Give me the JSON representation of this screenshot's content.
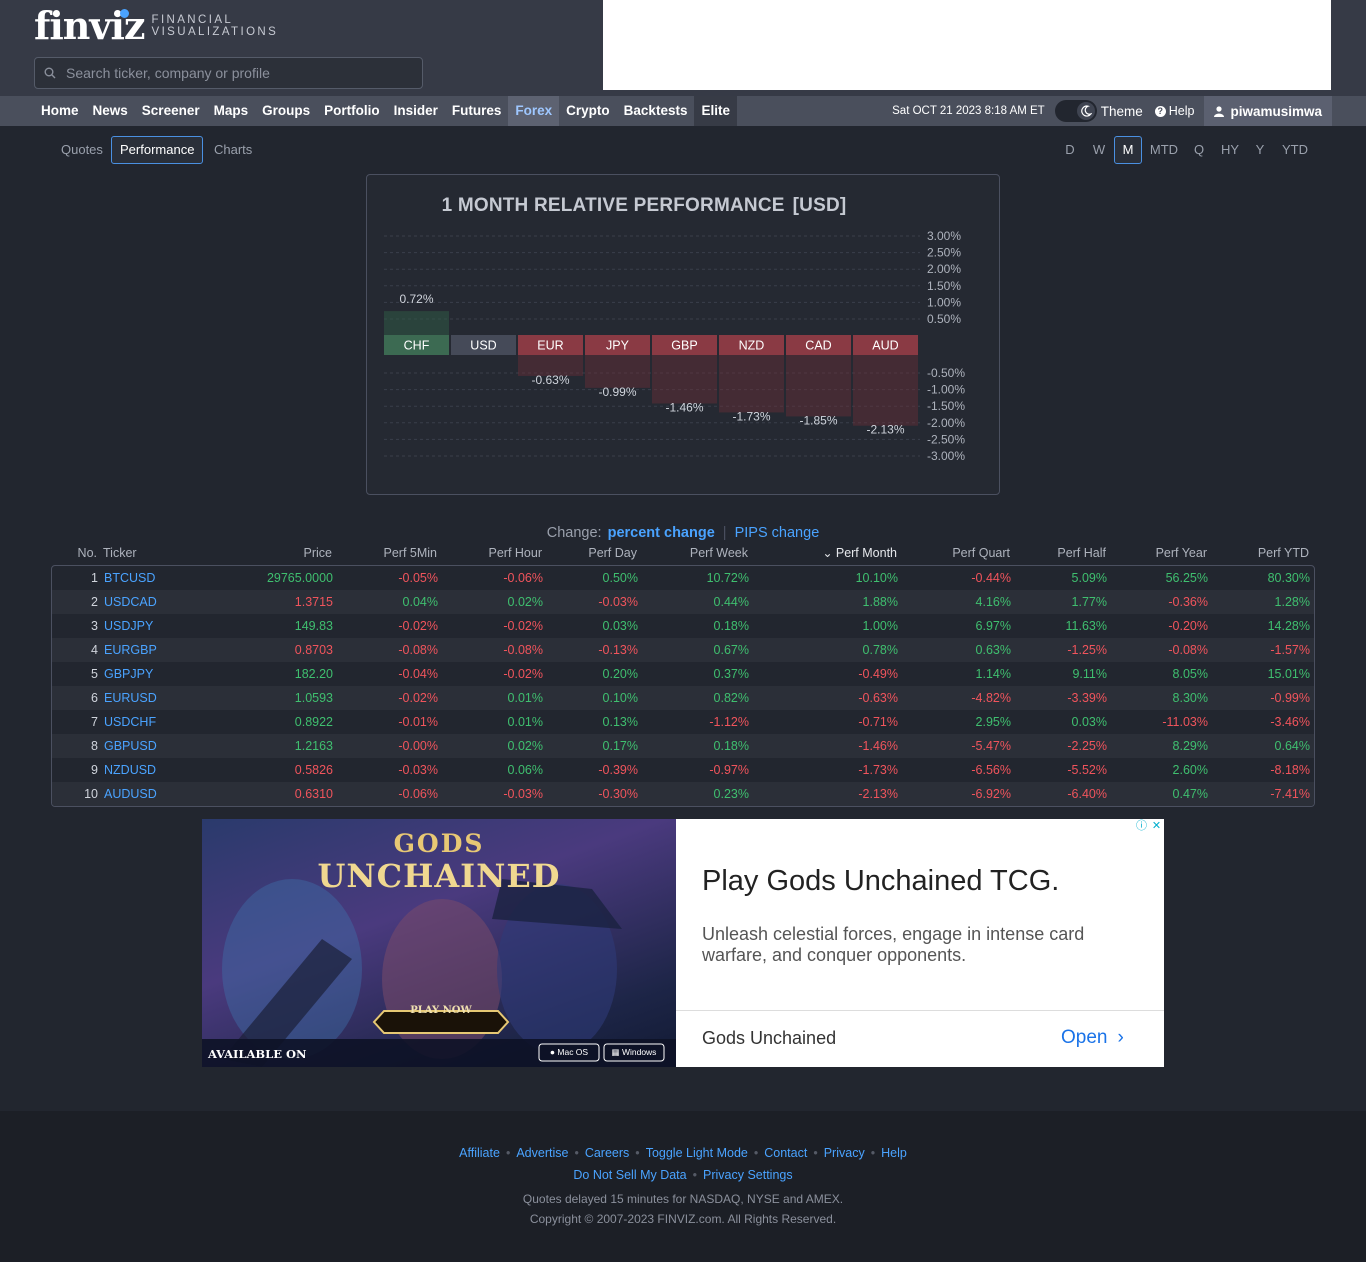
{
  "header": {
    "logo_text": "finviz",
    "logo_tagline_1": "FINANCIAL",
    "logo_tagline_2": "VISUALIZATIONS",
    "search_placeholder": "Search ticker, company or profile"
  },
  "nav": {
    "items": [
      "Home",
      "News",
      "Screener",
      "Maps",
      "Groups",
      "Portfolio",
      "Insider",
      "Futures",
      "Forex",
      "Crypto",
      "Backtests",
      "Elite"
    ],
    "active": "Forex",
    "datetime": "Sat OCT 21 2023 8:18 AM ET",
    "theme_label": "Theme",
    "help_label": "Help",
    "username": "piwamusimwa"
  },
  "subtabs": [
    "Quotes",
    "Performance",
    "Charts"
  ],
  "subtab_active": "Performance",
  "periods": [
    "D",
    "W",
    "M",
    "MTD",
    "Q",
    "HY",
    "Y",
    "YTD"
  ],
  "period_active": "M",
  "chart_data": {
    "type": "bar",
    "title": "1 MONTH RELATIVE PERFORMANCE",
    "title_unit": "[USD]",
    "categories": [
      "CHF",
      "USD",
      "EUR",
      "JPY",
      "GBP",
      "NZD",
      "CAD",
      "AUD"
    ],
    "values": [
      0.72,
      0,
      -0.63,
      -0.99,
      -1.46,
      -1.73,
      -1.85,
      -2.13
    ],
    "value_labels": [
      "0.72%",
      "",
      "-0.63%",
      "-0.99%",
      "-1.46%",
      "-1.73%",
      "-1.85%",
      "-2.13%"
    ],
    "positive_ticks": [
      "3.00%",
      "2.50%",
      "2.00%",
      "1.50%",
      "1.00%",
      "0.50%"
    ],
    "negative_ticks": [
      "-0.50%",
      "-1.00%",
      "-1.50%",
      "-2.00%",
      "-2.50%",
      "-3.00%"
    ],
    "ylim": [
      -3,
      3
    ],
    "colors": {
      "positive": "#2f5a46",
      "neutral": "#454a58",
      "negative": "#6a2f37"
    }
  },
  "change": {
    "label": "Change:",
    "percent": "percent change",
    "pips": "PIPS change"
  },
  "table": {
    "headers": [
      "No.",
      "Ticker",
      "Price",
      "Perf 5Min",
      "Perf Hour",
      "Perf Day",
      "Perf Week",
      "Perf Month",
      "Perf Quart",
      "Perf Half",
      "Perf Year",
      "Perf YTD"
    ],
    "rows": [
      [
        "1",
        "BTCUSD",
        "29765.0000",
        "-0.05%",
        "-0.06%",
        "0.50%",
        "10.72%",
        "10.10%",
        "-0.44%",
        "5.09%",
        "56.25%",
        "80.30%"
      ],
      [
        "2",
        "USDCAD",
        "1.3715",
        "0.04%",
        "0.02%",
        "-0.03%",
        "0.44%",
        "1.88%",
        "4.16%",
        "1.77%",
        "-0.36%",
        "1.28%"
      ],
      [
        "3",
        "USDJPY",
        "149.83",
        "-0.02%",
        "-0.02%",
        "0.03%",
        "0.18%",
        "1.00%",
        "6.97%",
        "11.63%",
        "-0.20%",
        "14.28%"
      ],
      [
        "4",
        "EURGBP",
        "0.8703",
        "-0.08%",
        "-0.08%",
        "-0.13%",
        "0.67%",
        "0.78%",
        "0.63%",
        "-1.25%",
        "-0.08%",
        "-1.57%"
      ],
      [
        "5",
        "GBPJPY",
        "182.20",
        "-0.04%",
        "-0.02%",
        "0.20%",
        "0.37%",
        "-0.49%",
        "1.14%",
        "9.11%",
        "8.05%",
        "15.01%"
      ],
      [
        "6",
        "EURUSD",
        "1.0593",
        "-0.02%",
        "0.01%",
        "0.10%",
        "0.82%",
        "-0.63%",
        "-4.82%",
        "-3.39%",
        "8.30%",
        "-0.99%"
      ],
      [
        "7",
        "USDCHF",
        "0.8922",
        "-0.01%",
        "0.01%",
        "0.13%",
        "-1.12%",
        "-0.71%",
        "2.95%",
        "0.03%",
        "-11.03%",
        "-3.46%"
      ],
      [
        "8",
        "GBPUSD",
        "1.2163",
        "-0.00%",
        "0.02%",
        "0.17%",
        "0.18%",
        "-1.46%",
        "-5.47%",
        "-2.25%",
        "8.29%",
        "0.64%"
      ],
      [
        "9",
        "NZDUSD",
        "0.5826",
        "-0.03%",
        "0.06%",
        "-0.39%",
        "-0.97%",
        "-1.73%",
        "-6.56%",
        "-5.52%",
        "2.60%",
        "-8.18%"
      ],
      [
        "10",
        "AUDUSD",
        "0.6310",
        "-0.06%",
        "-0.03%",
        "-0.30%",
        "0.23%",
        "-2.13%",
        "-6.92%",
        "-6.40%",
        "0.47%",
        "-7.41%"
      ]
    ],
    "price_direction": [
      "pos",
      "neg",
      "pos",
      "neg",
      "pos",
      "pos",
      "pos",
      "pos",
      "neg",
      "neg"
    ]
  },
  "ad": {
    "image_title_1": "GODS",
    "image_title_2": "UNCHAINED",
    "play_button": "PLAY NOW",
    "available_on": "AVAILABLE ON",
    "platform_1": "Mac OS",
    "platform_2": "Windows",
    "headline": "Play Gods Unchained TCG.",
    "description": "Unleash celestial forces, engage in intense card warfare, and conquer opponents.",
    "brand": "Gods Unchained",
    "cta": "Open"
  },
  "footer": {
    "links_row1": [
      "Affiliate",
      "Advertise",
      "Careers",
      "Toggle Light Mode",
      "Contact",
      "Privacy",
      "Help"
    ],
    "links_row2": [
      "Do Not Sell My Data",
      "Privacy Settings"
    ],
    "delay_note": "Quotes delayed 15 minutes for NASDAQ, NYSE and AMEX.",
    "copyright": "Copyright © 2007-2023 FINVIZ.com. All Rights Reserved."
  }
}
